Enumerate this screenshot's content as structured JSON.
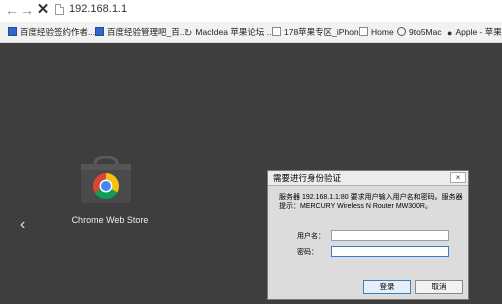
{
  "browser": {
    "back_glyph": "←",
    "forward_glyph": "→",
    "stop_glyph": "✕",
    "url": "192.168.1.1",
    "bookmarks": [
      {
        "label": "百度经验签约作者...",
        "icon": "baidu-icon"
      },
      {
        "label": "百度经验管理吧_百...",
        "icon": "baidu-icon"
      },
      {
        "label": "MacIdea 苹果论坛 ...",
        "icon": "refresh-curl-icon"
      },
      {
        "label": "178苹果专区_iPhon...",
        "icon": "page-icon"
      },
      {
        "label": "Home",
        "icon": "page-icon"
      },
      {
        "label": "9to5Mac",
        "icon": "circle-icon"
      },
      {
        "label": "Apple - 苹果",
        "icon": "apple-icon"
      }
    ]
  },
  "newtab": {
    "app_label": "Chrome Web Store",
    "left_arrow": "‹"
  },
  "auth_dialog": {
    "title": "需要进行身份验证",
    "close_glyph": "×",
    "message": "服务器 192.168.1.1:80 要求用户输入用户名和密码。服务器提示：MERCURY Wireless N Router MW300R。",
    "username_label": "用户名：",
    "password_label": "密码：",
    "username_value": "",
    "password_value": "",
    "login_button": "登录",
    "cancel_button": "取消"
  },
  "colors": {
    "page_background": "#3e3e3e",
    "dialog_background": "#dcdcdc",
    "chrome_red": "#db4437",
    "chrome_yellow": "#f4c20d",
    "chrome_green": "#0f9d58",
    "chrome_blue": "#4285f4"
  }
}
